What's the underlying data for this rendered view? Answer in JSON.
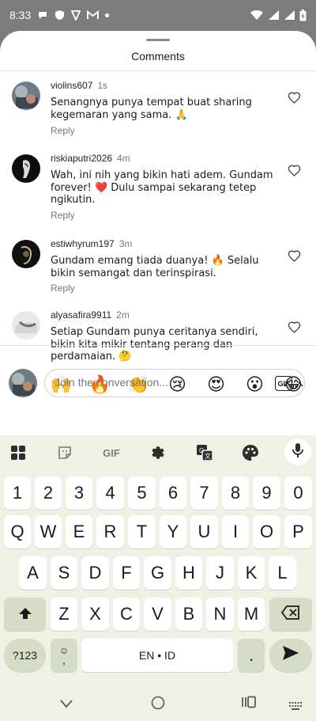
{
  "status_bar": {
    "time": "8:33"
  },
  "sheet": {
    "title": "Comments"
  },
  "comments": [
    {
      "user": "violins607",
      "ago": "1s",
      "text": "Senangnya punya tempat buat sharing kegemaran yang sama. 🙏",
      "reply": "Reply"
    },
    {
      "user": "riskiaputri2026",
      "ago": "4m",
      "text": "Wah, ini nih yang bikin hati adem. Gundam forever! ❤️ Dulu sampai sekarang tetep ngikutin.",
      "reply": "Reply"
    },
    {
      "user": "estiwhyrum197",
      "ago": "3m",
      "text": "Gundam emang tiada duanya! 🔥 Selalu bikin semangat dan terinspirasi.",
      "reply": "Reply"
    },
    {
      "user": "alyasafira9911",
      "ago": "2m",
      "text": "Setiap Gundam punya ceritanya sendiri, bikin kita mikir tentang perang dan perdamaian. 🤔",
      "reply": ""
    }
  ],
  "emoji_bar": [
    "❤️",
    "🙌",
    "🔥",
    "👏",
    "😢",
    "😍",
    "😮",
    "😂"
  ],
  "composer": {
    "placeholder": "Join the conversation...",
    "gif_label": "GIF"
  },
  "keyboard": {
    "toolbar": {
      "gif_label": "GIF"
    },
    "row1": [
      "1",
      "2",
      "3",
      "4",
      "5",
      "6",
      "7",
      "8",
      "9",
      "0"
    ],
    "row2": [
      "Q",
      "W",
      "E",
      "R",
      "T",
      "Y",
      "U",
      "I",
      "O",
      "P"
    ],
    "row3": [
      "A",
      "S",
      "D",
      "F",
      "G",
      "H",
      "J",
      "K",
      "L"
    ],
    "row4": [
      "Z",
      "X",
      "C",
      "V",
      "B",
      "N",
      "M"
    ],
    "symbols_label": "?123",
    "comma_label": ",",
    "space_label": "EN • ID",
    "period_label": "."
  }
}
